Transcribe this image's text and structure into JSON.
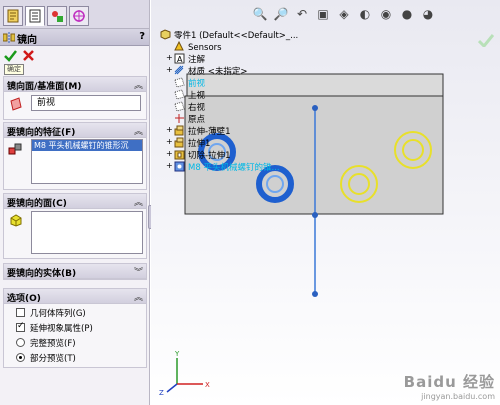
{
  "tabs": [
    {
      "name": "feature-manager-tab-icon"
    },
    {
      "name": "property-manager-tab-icon"
    },
    {
      "name": "configuration-manager-tab-icon"
    },
    {
      "name": "dimxpert-tab-icon"
    }
  ],
  "title": "镜向",
  "help": "?",
  "tooltip": "确定",
  "groups": {
    "plane": {
      "label": "镜向面/基准面(M)",
      "value": "前视"
    },
    "features": {
      "label": "要镜向的特征(F)",
      "items": [
        "M8 平头机械螺钉的锥形沉"
      ]
    },
    "faces": {
      "label": "要镜向的面(C)"
    },
    "bodies": {
      "label": "要镜向的实体(B)"
    },
    "options": {
      "label": "选项(O)",
      "items": [
        {
          "label": "几何体阵列(G)",
          "type": "checkbox",
          "checked": false
        },
        {
          "label": "延伸视象属性(P)",
          "type": "checkbox",
          "checked": true
        },
        {
          "label": "完整预览(F)",
          "type": "radio",
          "checked": false
        },
        {
          "label": "部分预览(T)",
          "type": "radio",
          "checked": true
        }
      ]
    }
  },
  "tree": {
    "root": "零件1 (Default<<Default>_...",
    "items": [
      {
        "label": "Sensors",
        "icon": "sensors-icon",
        "color": "#000000"
      },
      {
        "label": "注解",
        "icon": "annotations-icon",
        "color": "#000000"
      },
      {
        "label": "材质 <未指定>",
        "icon": "material-icon",
        "color": "#000000"
      },
      {
        "label": "前视",
        "icon": "plane-icon",
        "color": "#00b8e6"
      },
      {
        "label": "上视",
        "icon": "plane-icon",
        "color": "#000000"
      },
      {
        "label": "右视",
        "icon": "plane-icon",
        "color": "#000000"
      },
      {
        "label": "原点",
        "icon": "origin-icon",
        "color": "#000000"
      },
      {
        "label": "拉伸-薄壁1",
        "icon": "extrude-icon",
        "color": "#000000"
      },
      {
        "label": "拉伸1",
        "icon": "extrude-icon",
        "color": "#000000"
      },
      {
        "label": "切除-拉伸1",
        "icon": "cut-extrude-icon",
        "color": "#000000"
      },
      {
        "label": "M8 平头机械螺钉的锥...",
        "icon": "hole-wizard-icon",
        "color": "#00b8e6"
      }
    ]
  },
  "watermark": {
    "brand": "Baidu 经验",
    "url": "jingyan.baidu.com"
  },
  "colors": {
    "accent": "#3f6fc4",
    "selection": "#00b8e6",
    "preview": "#e8e02a",
    "mirror_feature": "#1e5fcf"
  }
}
